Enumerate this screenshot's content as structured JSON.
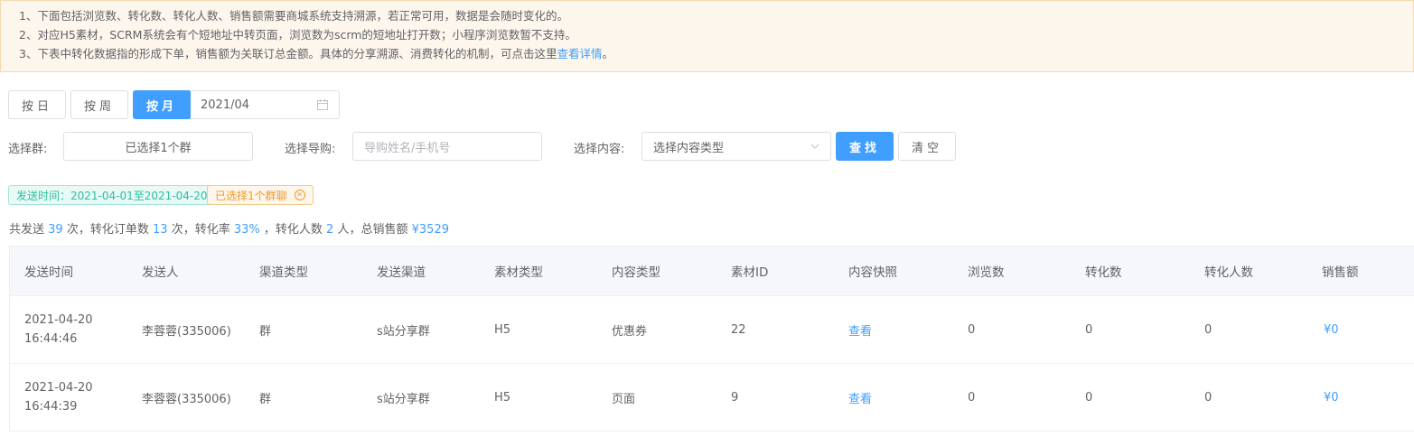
{
  "notice": {
    "line1": "1、下面包括浏览数、转化数、转化人数、销售额需要商城系统支持溯源，若正常可用，数据是会随时变化的。",
    "line2": "2、对应H5素材，SCRM系统会有个短地址中转页面，浏览数为scrm的短地址打开数；小程序浏览数暂不支持。",
    "line3_prefix": "3、下表中转化数据指的形成下单，销售额为关联订总金额。具体的分享溯源、消费转化的机制，可点击这里",
    "line3_link": "查看详情",
    "line3_suffix": "。"
  },
  "period": {
    "day_label": "按日",
    "week_label": "按周",
    "month_label": "按月",
    "selected": "month",
    "date_value": "2021/04",
    "calendar_icon": "calendar-icon"
  },
  "filters": {
    "group_label": "选择群:",
    "group_value": "已选择1个群",
    "guide_label": "选择导购:",
    "guide_placeholder": "导购姓名/手机号",
    "content_label": "选择内容:",
    "content_placeholder": "选择内容类型",
    "search_button": "查找",
    "clear_button": "清空"
  },
  "tags": {
    "time_tag": "发送时间：2021-04-01至2021-04-20",
    "group_tag": "已选择1个群聊"
  },
  "summary": {
    "p1": "共发送",
    "sends": "39",
    "p2": "次，转化订单数",
    "orders": "13",
    "p3": "次，转化率",
    "rate": "33%",
    "p4": "，转化人数",
    "people": "2",
    "p5": "人，总销售额",
    "total": "¥3529"
  },
  "table": {
    "headers": [
      "发送时间",
      "发送人",
      "渠道类型",
      "发送渠道",
      "素材类型",
      "内容类型",
      "素材ID",
      "内容快照",
      "浏览数",
      "转化数",
      "转化人数",
      "销售额"
    ],
    "rows": [
      {
        "date": "2021-04-20",
        "time": "16:44:46",
        "sender": "李蓉蓉(335006)",
        "channel_type": "群",
        "channel": "s站分享群",
        "material_type": "H5",
        "content_type": "优惠券",
        "material_id": "22",
        "snapshot": "查看",
        "views": "0",
        "conversions": "0",
        "converted_people": "0",
        "sales": "¥0"
      },
      {
        "date": "2021-04-20",
        "time": "16:44:39",
        "sender": "李蓉蓉(335006)",
        "channel_type": "群",
        "channel": "s站分享群",
        "material_type": "H5",
        "content_type": "页面",
        "material_id": "9",
        "snapshot": "查看",
        "views": "0",
        "conversions": "0",
        "converted_people": "0",
        "sales": "¥0"
      }
    ]
  },
  "colors": {
    "primary": "#409eff",
    "notice_bg": "#fdf6ec",
    "tag_green": "#2dbf9f",
    "tag_orange": "#f09a2b"
  }
}
